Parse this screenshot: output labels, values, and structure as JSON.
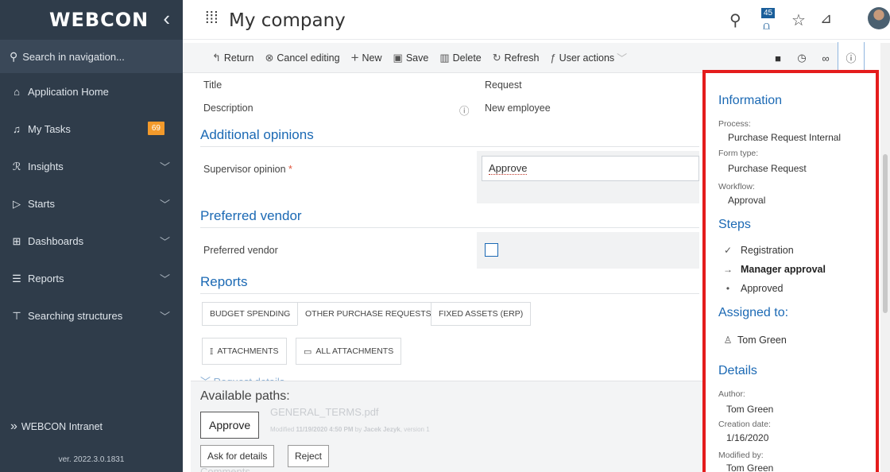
{
  "sidebar": {
    "logo": "WEBCON",
    "search_placeholder": "Search in navigation...",
    "items": [
      {
        "label": "Application Home",
        "icon": "home-icon"
      },
      {
        "label": "My Tasks",
        "icon": "bell-icon",
        "badge": "69"
      },
      {
        "label": "Insights",
        "icon": "insights-icon"
      },
      {
        "label": "Starts",
        "icon": "play-icon"
      },
      {
        "label": "Dashboards",
        "icon": "dashboard-icon"
      },
      {
        "label": "Reports",
        "icon": "reports-icon"
      },
      {
        "label": "Searching structures",
        "icon": "structure-icon"
      }
    ],
    "intranet": "WEBCON Intranet",
    "version": "ver. 2022.3.0.1831"
  },
  "header": {
    "title": "My company",
    "notification_count": "45"
  },
  "toolbar": {
    "return": "Return",
    "cancel_editing": "Cancel editing",
    "new": "New",
    "save": "Save",
    "delete": "Delete",
    "refresh": "Refresh",
    "user_actions": "User actions"
  },
  "form": {
    "title_label": "Title",
    "title_value": "Request",
    "description_label": "Description",
    "description_value": "New employee",
    "section_opinions": "Additional opinions",
    "supervisor_label": "Supervisor opinion",
    "supervisor_required": "*",
    "supervisor_value": "Approve",
    "section_vendor": "Preferred vendor",
    "vendor_label": "Preferred vendor",
    "vendor_checked": false,
    "section_reports": "Reports",
    "report_tabs": [
      "BUDGET SPENDING",
      "OTHER PURCHASE REQUESTS",
      "FIXED ASSETS (ERP)"
    ],
    "attachment_tabs": [
      "ATTACHMENTS",
      "ALL ATTACHMENTS"
    ],
    "request_details": "Request details",
    "ghost_file": "GENERAL_TERMS.pdf",
    "ghost_modified_prefix": "Modified",
    "ghost_modified_date": "11/19/2020 4:50 PM",
    "ghost_by": "by",
    "ghost_author": "Jacek Jezyk",
    "ghost_version": "version 1",
    "ghost_comments": "Comments"
  },
  "paths": {
    "title": "Available paths:",
    "approve": "Approve",
    "ask_for_details": "Ask for details",
    "reject": "Reject"
  },
  "info": {
    "heading": "Information",
    "process_label": "Process:",
    "process_value": "Purchase Request Internal",
    "form_type_label": "Form type:",
    "form_type_value": "Purchase Request",
    "workflow_label": "Workflow:",
    "workflow_value": "Approval",
    "steps_heading": "Steps",
    "steps": [
      {
        "label": "Registration",
        "state": "done"
      },
      {
        "label": "Manager approval",
        "state": "current"
      },
      {
        "label": "Approved",
        "state": "pending"
      }
    ],
    "assigned_heading": "Assigned to:",
    "assigned_value": "Tom Green",
    "details_heading": "Details",
    "author_label": "Author:",
    "author_value": "Tom Green",
    "creation_label": "Creation date:",
    "creation_value": "1/16/2020",
    "modified_label": "Modified by:",
    "modified_value": "Tom Green"
  },
  "colors": {
    "sidebar_bg": "#2f3c4a",
    "accent_blue": "#1b69b4",
    "badge_orange": "#f39a2b",
    "highlight_red": "#e41c1c"
  }
}
